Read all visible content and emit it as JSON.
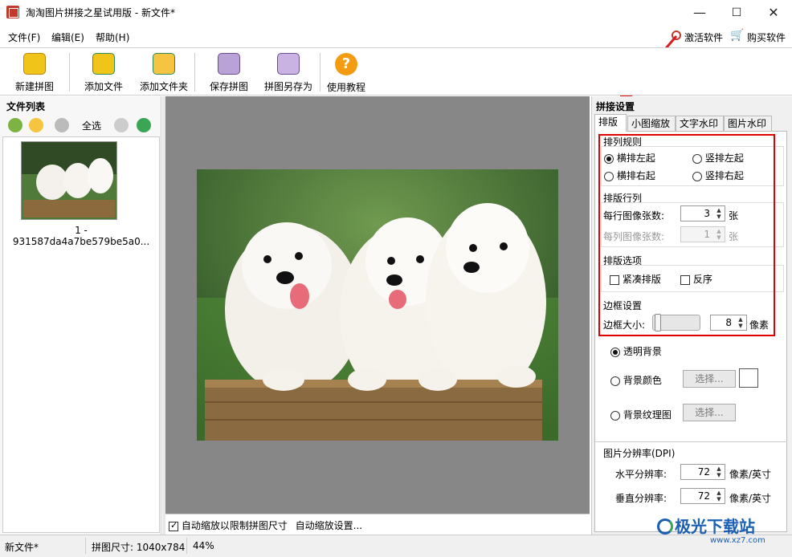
{
  "window": {
    "title": "淘淘图片拼接之星试用版 - 新文件*",
    "minimize": "—",
    "maximize": "☐",
    "close": "✕"
  },
  "menu": {
    "file": "文件(F)",
    "edit": "编辑(E)",
    "help": "帮助(H)",
    "activate": "激活软件",
    "buy": "购买软件"
  },
  "toolbar": {
    "new": "新建拼图",
    "add_file": "添加文件",
    "add_folder": "添加文件夹",
    "save": "保存拼图",
    "save_as": "拼图另存为",
    "tutorial": "使用教程"
  },
  "left": {
    "header": "文件列表",
    "select_all": "全选",
    "file_name_line1": "1 -",
    "file_name_line2": "931587da4a7be579be5a0..."
  },
  "canvas": {
    "auto_scale": "自动缩放以限制拼图尺寸",
    "auto_scale_settings": "自动缩放设置..."
  },
  "right": {
    "header": "拼接设置",
    "tabs": [
      "排版",
      "小图缩放",
      "文字水印",
      "图片水印"
    ],
    "arrange_rule": {
      "title": "排列规则",
      "opt1": "横排左起",
      "opt2": "竖排左起",
      "opt3": "横排右起",
      "opt4": "竖排右起",
      "selected": "横排左起"
    },
    "rows_cols": {
      "title": "排版行列",
      "per_row_label": "每行图像张数:",
      "per_row_value": "3",
      "per_row_unit": "张",
      "per_col_label": "每列图像张数:",
      "per_col_value": "1",
      "per_col_unit": "张"
    },
    "options": {
      "title": "排版选项",
      "compact": "紧凑排版",
      "reverse": "反序"
    },
    "border": {
      "title": "边框设置",
      "size_label": "边框大小:",
      "size_value": "8",
      "unit": "像素"
    },
    "background": {
      "transparent": "透明背景",
      "color": "背景颜色",
      "texture": "背景纹理图",
      "choose": "选择..."
    },
    "dpi": {
      "title": "图片分辨率(DPI)",
      "h_label": "水平分辨率:",
      "h_value": "72",
      "v_label": "垂直分辨率:",
      "v_value": "72",
      "unit": "像素/英寸"
    }
  },
  "status": {
    "file": "新文件*",
    "size": "拼图尺寸: 1040x784",
    "zoom": "44%"
  },
  "watermark": {
    "text": "极光下载站",
    "url": "www.xz7.com"
  },
  "colors": {
    "accent_red": "#e00000",
    "watermark_blue": "#1a5fb4"
  }
}
